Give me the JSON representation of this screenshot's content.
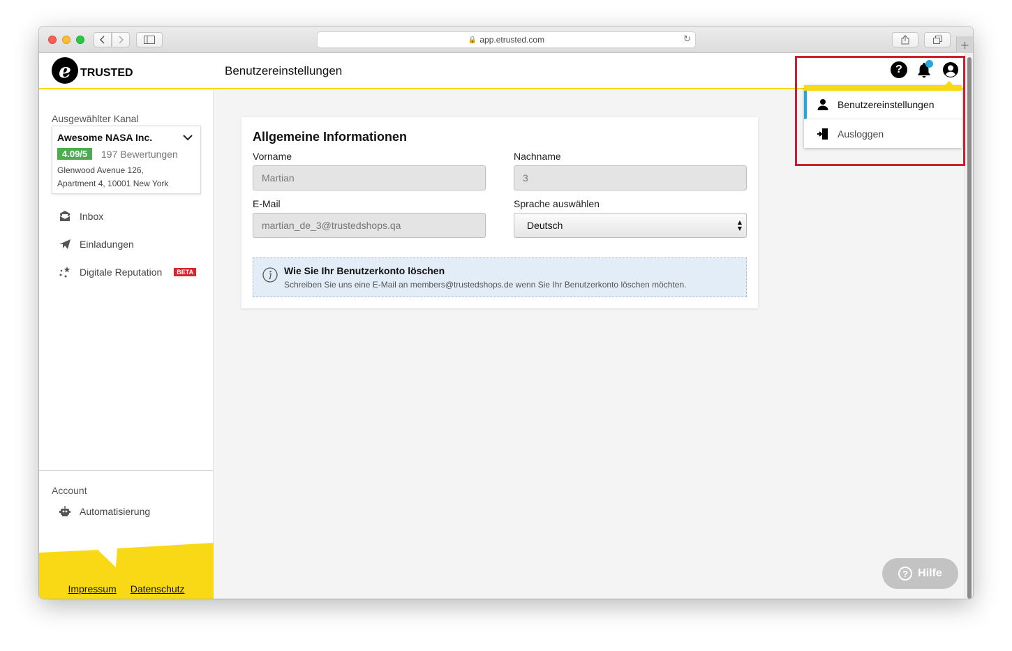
{
  "browser": {
    "url": "app.etrusted.com",
    "plus_label": "+"
  },
  "header": {
    "logo_letter": "e",
    "logo_text": "TRUSTED",
    "page_title": "Benutzereinstellungen",
    "help_symbol": "?",
    "notification_dot_color": "#27a6dc"
  },
  "user_menu": {
    "items": [
      {
        "label": "Benutzereinstellungen",
        "icon": "user-icon",
        "active": true
      },
      {
        "label": "Ausloggen",
        "icon": "logout-icon",
        "active": false
      }
    ]
  },
  "sidebar": {
    "channel_label": "Ausgewählter Kanal",
    "channel": {
      "name": "Awesome NASA Inc.",
      "rating": "4.09/5",
      "reviews": "197 Bewertungen",
      "address_line1": "Glenwood Avenue 126,",
      "address_line2": "Apartment 4, 10001 New York"
    },
    "nav": [
      {
        "label": "Inbox",
        "icon": "inbox-icon"
      },
      {
        "label": "Einladungen",
        "icon": "paper-plane-icon"
      },
      {
        "label": "Digitale Reputation",
        "icon": "stars-icon",
        "badge": "BETA"
      }
    ],
    "account_label": "Account",
    "account_nav": [
      {
        "label": "Automatisierung",
        "icon": "robot-icon"
      }
    ],
    "footer_links": [
      "Impressum",
      "Datenschutz"
    ]
  },
  "form": {
    "title": "Allgemeine Informationen",
    "first_name_label": "Vorname",
    "first_name_value": "Martian",
    "last_name_label": "Nachname",
    "last_name_value": "3",
    "email_label": "E-Mail",
    "email_value": "martian_de_3@trustedshops.qa",
    "language_label": "Sprache auswählen",
    "language_value": "Deutsch",
    "info_title": "Wie Sie Ihr Benutzerkonto löschen",
    "info_text": "Schreiben Sie uns eine E-Mail an members@trustedshops.de wenn Sie Ihr Benutzerkonto löschen möchten."
  },
  "help_button": {
    "label": "Hilfe",
    "symbol": "?"
  },
  "colors": {
    "brand_yellow": "#f9d915",
    "rating_green": "#4dac52",
    "beta_red": "#d8262e",
    "highlight_red": "#c8202f",
    "accent_blue": "#27a6dc"
  }
}
